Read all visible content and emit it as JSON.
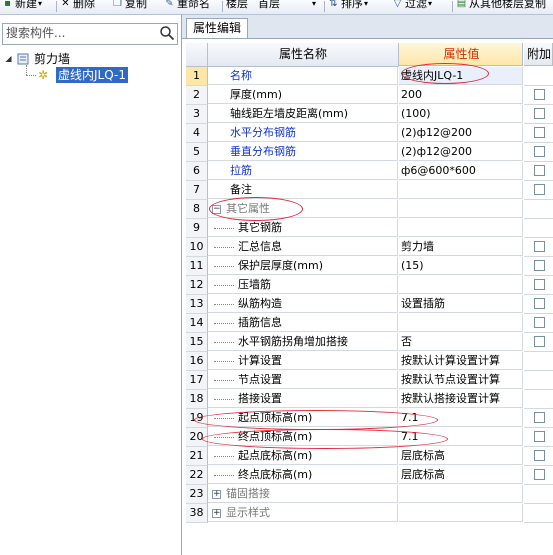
{
  "toolbar": {
    "items": [
      {
        "label": "新建",
        "icon": "new-icon"
      },
      {
        "label": "删除",
        "icon": "delete-icon"
      },
      {
        "label": "复制",
        "icon": "copy-icon"
      },
      {
        "label": "重命名",
        "icon": "rename-icon"
      },
      {
        "label": "楼层",
        "icon": ""
      },
      {
        "label": "首层",
        "icon": ""
      },
      {
        "label": "排序",
        "icon": "sort-icon"
      },
      {
        "label": "过滤",
        "icon": "filter-icon"
      },
      {
        "label": "从其他楼层复制",
        "icon": "copy-floor-icon"
      }
    ]
  },
  "sidebar": {
    "search_placeholder": "搜索构件...",
    "tree": {
      "root": "剪力墙",
      "child": "虚线内JLQ-1"
    }
  },
  "panel": {
    "tab": "属性编辑",
    "columns": [
      "属性名称",
      "属性值",
      "附加"
    ],
    "rows": [
      {
        "num": "1",
        "name": "名称",
        "value": "虚线内JLQ-1",
        "style": "blue",
        "check": false
      },
      {
        "num": "2",
        "name": "厚度(mm)",
        "value": "200",
        "style": "",
        "check": true
      },
      {
        "num": "3",
        "name": "轴线距左墙皮距离(mm)",
        "value": "(100)",
        "style": "",
        "check": true
      },
      {
        "num": "4",
        "name": "水平分布钢筋",
        "value": "(2)ф12@200",
        "style": "blue",
        "check": true
      },
      {
        "num": "5",
        "name": "垂直分布钢筋",
        "value": "(2)ф12@200",
        "style": "blue",
        "check": true
      },
      {
        "num": "6",
        "name": "拉筋",
        "value": "ф6@600*600",
        "style": "blue",
        "check": true
      },
      {
        "num": "7",
        "name": "备注",
        "value": "",
        "style": "",
        "check": true
      },
      {
        "num": "8",
        "name": "其它属性",
        "value": "",
        "style": "group-open",
        "check": false
      },
      {
        "num": "9",
        "name": "其它钢筋",
        "value": "",
        "style": "child",
        "check": false
      },
      {
        "num": "10",
        "name": "汇总信息",
        "value": "剪力墙",
        "style": "child",
        "check": true
      },
      {
        "num": "11",
        "name": "保护层厚度(mm)",
        "value": "(15)",
        "style": "child",
        "check": true
      },
      {
        "num": "12",
        "name": "压墙筋",
        "value": "",
        "style": "child",
        "check": true
      },
      {
        "num": "13",
        "name": "纵筋构造",
        "value": "设置插筋",
        "style": "child",
        "check": true
      },
      {
        "num": "14",
        "name": "插筋信息",
        "value": "",
        "style": "child",
        "check": true
      },
      {
        "num": "15",
        "name": "水平钢筋拐角增加搭接",
        "value": "否",
        "style": "child",
        "check": true
      },
      {
        "num": "16",
        "name": "计算设置",
        "value": "按默认计算设置计算",
        "style": "child",
        "check": false
      },
      {
        "num": "17",
        "name": "节点设置",
        "value": "按默认节点设置计算",
        "style": "child",
        "check": false
      },
      {
        "num": "18",
        "name": "搭接设置",
        "value": "按默认搭接设置计算",
        "style": "child",
        "check": false
      },
      {
        "num": "19",
        "name": "起点顶标高(m)",
        "value": "7.1",
        "style": "child",
        "check": true
      },
      {
        "num": "20",
        "name": "终点顶标高(m)",
        "value": "7.1",
        "style": "child",
        "check": true
      },
      {
        "num": "21",
        "name": "起点底标高(m)",
        "value": "层底标高",
        "style": "child",
        "check": true
      },
      {
        "num": "22",
        "name": "终点底标高(m)",
        "value": "层底标高",
        "style": "child",
        "check": true
      },
      {
        "num": "23",
        "name": "锚固搭接",
        "value": "",
        "style": "group-closed",
        "check": false
      },
      {
        "num": "38",
        "name": "显示样式",
        "value": "",
        "style": "group-closed",
        "check": false
      }
    ]
  },
  "colors": {
    "highlight_ellipse": "#e0283c",
    "blue_text": "#1133cc",
    "header_value_bg": "#fde7a8"
  }
}
